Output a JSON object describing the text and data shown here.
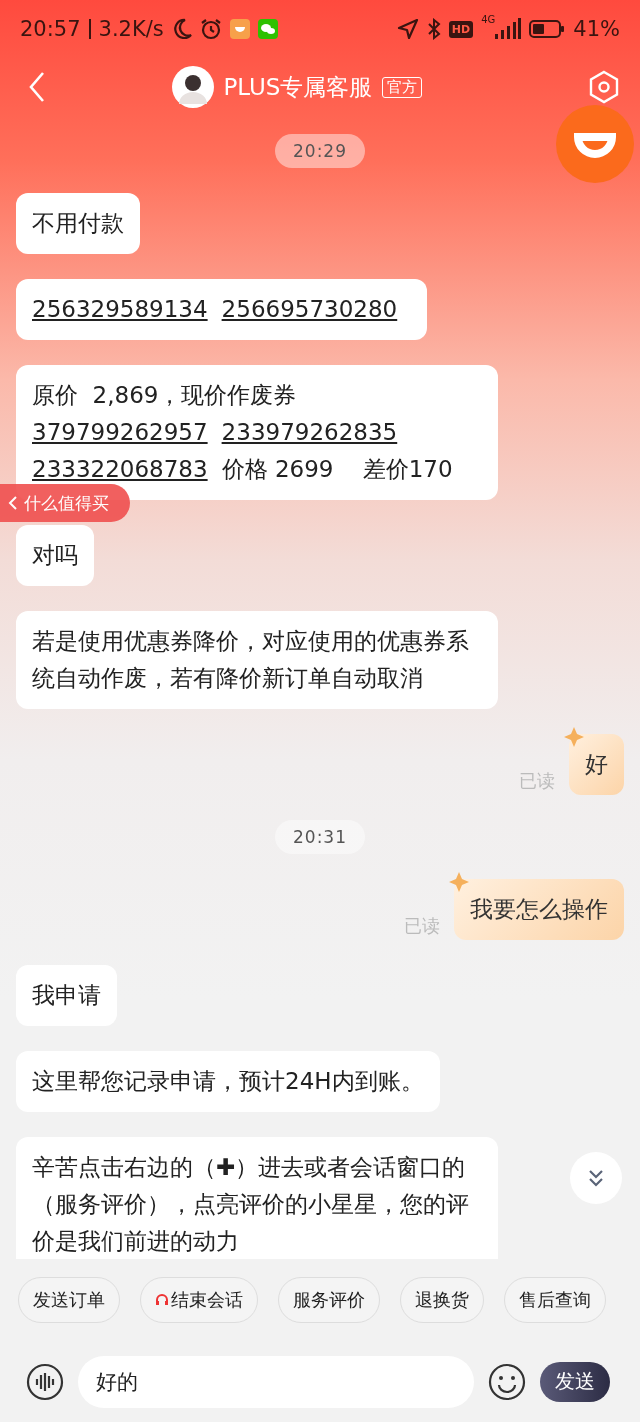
{
  "status_bar": {
    "time": "20:57",
    "speed": "3.2K/s",
    "hd": "HD",
    "network": "4G",
    "battery": "41%"
  },
  "header": {
    "title": "PLUS专属客服",
    "badge": "官方"
  },
  "messages": [
    {
      "kind": "time",
      "text": "20:29"
    },
    {
      "kind": "incoming",
      "parts": [
        {
          "kind": "text",
          "text": "不用付款"
        }
      ]
    },
    {
      "kind": "incoming",
      "parts": [
        {
          "kind": "link",
          "text": "256329589134"
        },
        {
          "kind": "link",
          "text": "256695730280"
        }
      ]
    },
    {
      "kind": "incoming",
      "parts": [
        {
          "kind": "text",
          "text": "原价  2,869，现价作废券"
        },
        {
          "kind": "link",
          "text": "379799262957"
        },
        {
          "kind": "link",
          "text": "233979262835"
        },
        {
          "kind": "link",
          "text": "233322068783"
        },
        {
          "kind": "text",
          "text": "价格 2699    差价170"
        }
      ]
    },
    {
      "kind": "incoming",
      "parts": [
        {
          "kind": "text",
          "text": "对吗"
        }
      ]
    },
    {
      "kind": "incoming",
      "parts": [
        {
          "kind": "text",
          "text": "若是使用优惠券降价，对应使用的优惠券系统自动作废，若有降价新订单自动取消"
        }
      ]
    },
    {
      "kind": "outgoing",
      "read": "已读",
      "parts": [
        {
          "kind": "text",
          "text": "好"
        }
      ]
    },
    {
      "kind": "time",
      "text": "20:31"
    },
    {
      "kind": "outgoing",
      "read": "已读",
      "parts": [
        {
          "kind": "text",
          "text": "我要怎么操作"
        }
      ]
    },
    {
      "kind": "incoming",
      "parts": [
        {
          "kind": "text",
          "text": "我申请"
        }
      ]
    },
    {
      "kind": "incoming",
      "parts": [
        {
          "kind": "text",
          "text": "这里帮您记录申请，预计24H内到账。"
        }
      ]
    },
    {
      "kind": "incoming",
      "parts": [
        {
          "kind": "text",
          "text": "辛苦点击右边的（✚）进去或者会话窗口的（服务评价），点亮评价的小星星，您的评价是我们前进的动力"
        }
      ]
    }
  ],
  "floating_tab": {
    "label": "什么值得买"
  },
  "quick_replies": [
    {
      "label": "发送订单",
      "kind": "plain"
    },
    {
      "label": "结束会话",
      "kind": "headset"
    },
    {
      "label": "服务评价",
      "kind": "plain"
    },
    {
      "label": "退换货",
      "kind": "plain"
    },
    {
      "label": "售后查询",
      "kind": "plain"
    }
  ],
  "input": {
    "value": "好的"
  },
  "send_button": "发送"
}
